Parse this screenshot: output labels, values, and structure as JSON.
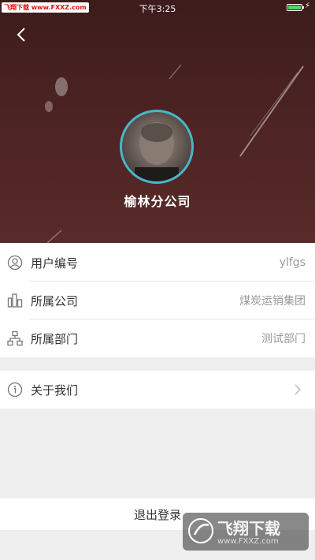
{
  "status_bar": {
    "time": "下午3:25",
    "watermark": "飞翔下载 www.FXXZ.com"
  },
  "profile": {
    "name": "榆林分公司"
  },
  "info_rows": [
    {
      "icon": "user-icon",
      "label": "用户编号",
      "value": "ylfgs"
    },
    {
      "icon": "building-icon",
      "label": "所属公司",
      "value": "煤炭运销集团"
    },
    {
      "icon": "org-chart-icon",
      "label": "所属部门",
      "value": "测试部门"
    }
  ],
  "about": {
    "icon": "info-icon",
    "label": "关于我们"
  },
  "logout": {
    "label": "退出登录"
  },
  "watermark": {
    "title": "飞翔下载",
    "url": "www.FXXZ.com"
  },
  "colors": {
    "header": "#4a2222",
    "avatar_border": "#49b6c9",
    "background": "#efefef"
  }
}
